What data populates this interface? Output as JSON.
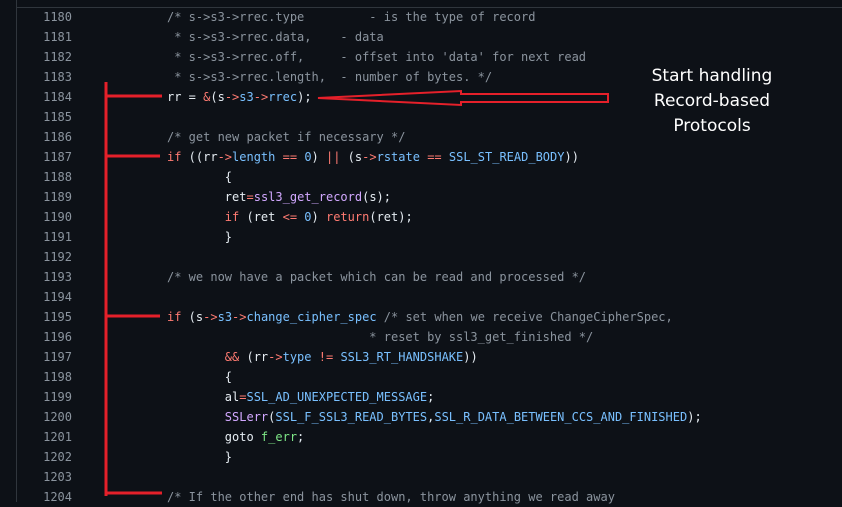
{
  "code_lines": [
    {
      "n": "1180",
      "tokens": [
        {
          "t": "/* s->s3->rrec.type         - is the type of record",
          "c": "c"
        }
      ]
    },
    {
      "n": "1181",
      "tokens": [
        {
          "t": " * s->s3->rrec.data,    - data",
          "c": "c"
        }
      ]
    },
    {
      "n": "1182",
      "tokens": [
        {
          "t": " * s->s3->rrec.off,     - offset into 'data' for next read",
          "c": "c"
        }
      ]
    },
    {
      "n": "1183",
      "tokens": [
        {
          "t": " * s->s3->rrec.length,  - number of bytes. */",
          "c": "c"
        }
      ]
    },
    {
      "n": "1184",
      "tokens": [
        {
          "t": "rr",
          "c": "t"
        },
        {
          "t": " = ",
          "c": "t"
        },
        {
          "t": "&",
          "c": "k"
        },
        {
          "t": "(s",
          "c": "t"
        },
        {
          "t": "->",
          "c": "k"
        },
        {
          "t": "s3",
          "c": "p"
        },
        {
          "t": "->",
          "c": "k"
        },
        {
          "t": "rrec",
          "c": "p"
        },
        {
          "t": ");",
          "c": "t"
        }
      ]
    },
    {
      "n": "1185",
      "tokens": []
    },
    {
      "n": "1186",
      "tokens": [
        {
          "t": "/* get new packet if necessary */",
          "c": "c"
        }
      ]
    },
    {
      "n": "1187",
      "tokens": [
        {
          "t": "if",
          "c": "k"
        },
        {
          "t": " ((rr",
          "c": "t"
        },
        {
          "t": "->",
          "c": "k"
        },
        {
          "t": "length",
          "c": "p"
        },
        {
          "t": " ",
          "c": "t"
        },
        {
          "t": "==",
          "c": "k"
        },
        {
          "t": " ",
          "c": "t"
        },
        {
          "t": "0",
          "c": "p"
        },
        {
          "t": ") ",
          "c": "t"
        },
        {
          "t": "||",
          "c": "k"
        },
        {
          "t": " (s",
          "c": "t"
        },
        {
          "t": "->",
          "c": "k"
        },
        {
          "t": "rstate",
          "c": "p"
        },
        {
          "t": " ",
          "c": "t"
        },
        {
          "t": "==",
          "c": "k"
        },
        {
          "t": " ",
          "c": "t"
        },
        {
          "t": "SSL_ST_READ_BODY",
          "c": "p"
        },
        {
          "t": "))",
          "c": "t"
        }
      ]
    },
    {
      "n": "1188",
      "tokens": [
        {
          "t": "        {",
          "c": "t"
        }
      ]
    },
    {
      "n": "1189",
      "tokens": [
        {
          "t": "        ret",
          "c": "t"
        },
        {
          "t": "=",
          "c": "k"
        },
        {
          "t": "ssl3_get_record",
          "c": "f"
        },
        {
          "t": "(s);",
          "c": "t"
        }
      ]
    },
    {
      "n": "1190",
      "tokens": [
        {
          "t": "        ",
          "c": "t"
        },
        {
          "t": "if",
          "c": "k"
        },
        {
          "t": " (ret ",
          "c": "t"
        },
        {
          "t": "<=",
          "c": "k"
        },
        {
          "t": " ",
          "c": "t"
        },
        {
          "t": "0",
          "c": "p"
        },
        {
          "t": ") ",
          "c": "t"
        },
        {
          "t": "return",
          "c": "k"
        },
        {
          "t": "(ret);",
          "c": "t"
        }
      ]
    },
    {
      "n": "1191",
      "tokens": [
        {
          "t": "        }",
          "c": "t"
        }
      ]
    },
    {
      "n": "1192",
      "tokens": []
    },
    {
      "n": "1193",
      "tokens": [
        {
          "t": "/* we now have a packet which can be read and processed */",
          "c": "c"
        }
      ]
    },
    {
      "n": "1194",
      "tokens": []
    },
    {
      "n": "1195",
      "tokens": [
        {
          "t": "if",
          "c": "k"
        },
        {
          "t": " (s",
          "c": "t"
        },
        {
          "t": "->",
          "c": "k"
        },
        {
          "t": "s3",
          "c": "p"
        },
        {
          "t": "->",
          "c": "k"
        },
        {
          "t": "change_cipher_spec",
          "c": "p"
        },
        {
          "t": " /* set when we receive ChangeCipherSpec,",
          "c": "c"
        }
      ]
    },
    {
      "n": "1196",
      "tokens": [
        {
          "t": "                            * reset by ssl3_get_finished */",
          "c": "c"
        }
      ]
    },
    {
      "n": "1197",
      "tokens": [
        {
          "t": "        ",
          "c": "t"
        },
        {
          "t": "&&",
          "c": "k"
        },
        {
          "t": " (rr",
          "c": "t"
        },
        {
          "t": "->",
          "c": "k"
        },
        {
          "t": "type",
          "c": "p"
        },
        {
          "t": " ",
          "c": "t"
        },
        {
          "t": "!=",
          "c": "k"
        },
        {
          "t": " ",
          "c": "t"
        },
        {
          "t": "SSL3_RT_HANDSHAKE",
          "c": "p"
        },
        {
          "t": "))",
          "c": "t"
        }
      ]
    },
    {
      "n": "1198",
      "tokens": [
        {
          "t": "        {",
          "c": "t"
        }
      ]
    },
    {
      "n": "1199",
      "tokens": [
        {
          "t": "        al",
          "c": "t"
        },
        {
          "t": "=",
          "c": "k"
        },
        {
          "t": "SSL_AD_UNEXPECTED_MESSAGE",
          "c": "p"
        },
        {
          "t": ";",
          "c": "t"
        }
      ]
    },
    {
      "n": "1200",
      "tokens": [
        {
          "t": "        ",
          "c": "t"
        },
        {
          "t": "SSLerr",
          "c": "f"
        },
        {
          "t": "(",
          "c": "t"
        },
        {
          "t": "SSL_F_SSL3_READ_BYTES",
          "c": "p"
        },
        {
          "t": ",",
          "c": "t"
        },
        {
          "t": "SSL_R_DATA_BETWEEN_CCS_AND_FINISHED",
          "c": "p"
        },
        {
          "t": ");",
          "c": "t"
        }
      ]
    },
    {
      "n": "1201",
      "tokens": [
        {
          "t": "        goto ",
          "c": "t"
        },
        {
          "t": "f_err",
          "c": "g"
        },
        {
          "t": ";",
          "c": "t"
        }
      ]
    },
    {
      "n": "1202",
      "tokens": [
        {
          "t": "        }",
          "c": "t"
        }
      ]
    },
    {
      "n": "1203",
      "tokens": []
    },
    {
      "n": "1204",
      "tokens": [
        {
          "t": "/* If the other end has shut down, throw anything we read away",
          "c": "c"
        }
      ]
    }
  ],
  "annotation": {
    "lines": [
      "Start handling",
      "Record-based",
      "Protocols"
    ],
    "marker_color": "#e5202a"
  },
  "icons": [
    "left-arrow-outline-icon",
    "bracket-marker-icon"
  ]
}
